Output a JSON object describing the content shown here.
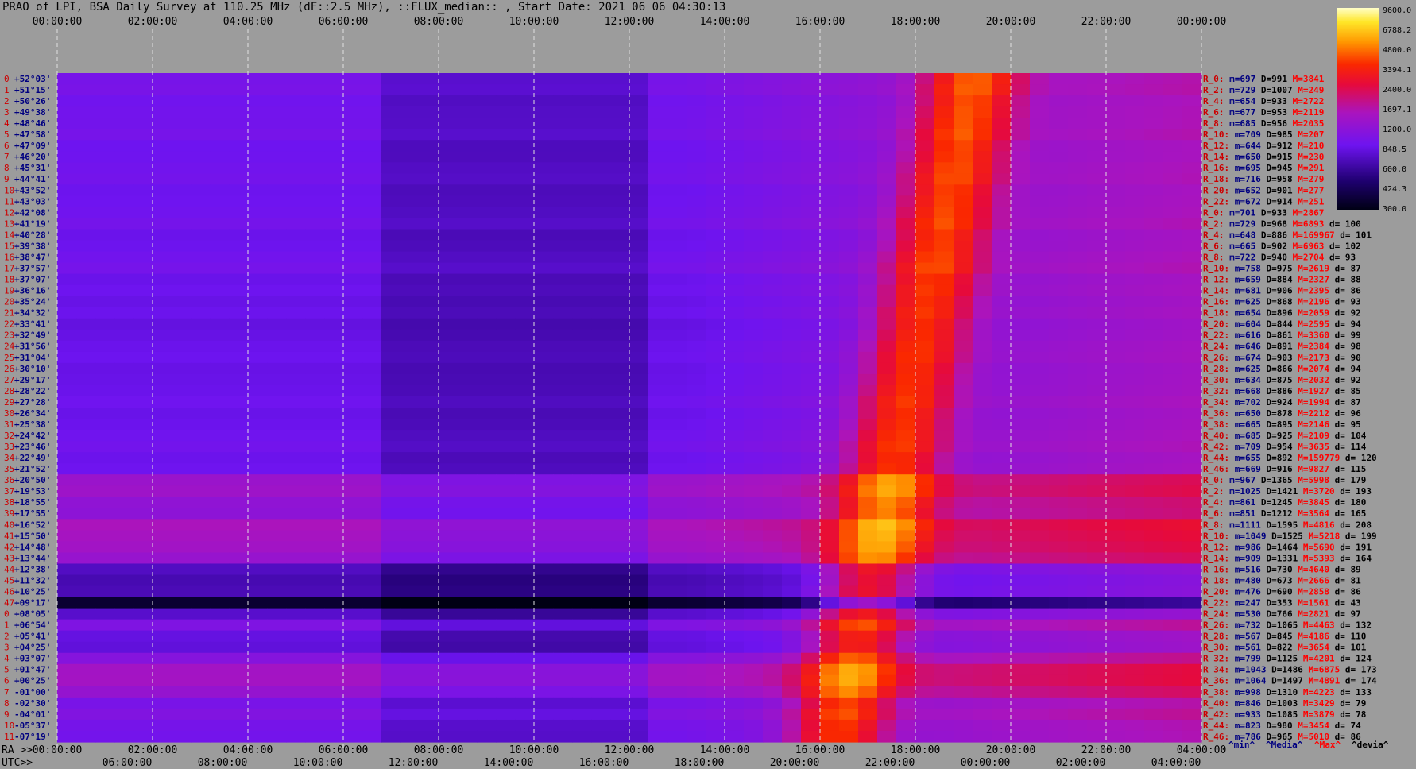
{
  "title": "PRAO of LPI, BSA Daily Survey at 110.25 MHz (dF::2.5 MHz), ::FLUX_median:: , Start Date: 2021 06 06 04:30:13",
  "chart_data": {
    "type": "heatmap",
    "x_top_ticks": [
      "00:00:00",
      "02:00:00",
      "04:00:00",
      "06:00:00",
      "08:00:00",
      "10:00:00",
      "12:00:00",
      "14:00:00",
      "16:00:00",
      "18:00:00",
      "20:00:00",
      "22:00:00",
      "00:00:00"
    ],
    "ra_label": "RA >>",
    "ra_ticks": [
      "00:00:00",
      "02:00:00",
      "04:00:00",
      "06:00:00",
      "08:00:00",
      "10:00:00",
      "12:00:00",
      "14:00:00",
      "16:00:00",
      "18:00:00",
      "20:00:00",
      "22:00:00",
      "04:00:00"
    ],
    "utc_label": "UTC>>",
    "utc_ticks": [
      "06:00:00",
      "08:00:00",
      "10:00:00",
      "12:00:00",
      "14:00:00",
      "16:00:00",
      "18:00:00",
      "20:00:00",
      "22:00:00",
      "00:00:00",
      "02:00:00",
      "04:00:00"
    ],
    "declinations": [
      "+52°03'",
      "+51°15'",
      "+50°26'",
      "+49°38'",
      "+48°46'",
      "+47°58'",
      "+47°09'",
      "+46°20'",
      "+45°31'",
      "+44°41'",
      "+43°52'",
      "+43°03'",
      "+42°08'",
      "+41°19'",
      "+40°28'",
      "+39°38'",
      "+38°47'",
      "+37°57'",
      "+37°07'",
      "+36°16'",
      "+35°24'",
      "+34°32'",
      "+33°41'",
      "+32°49'",
      "+31°56'",
      "+31°04'",
      "+30°10'",
      "+29°17'",
      "+28°22'",
      "+27°28'",
      "+26°34'",
      "+25°38'",
      "+24°42'",
      "+23°46'",
      "+22°49'",
      "+21°52'",
      "+20°50'",
      "+19°53'",
      "+18°55'",
      "+17°55'",
      "+16°52'",
      "+15°50'",
      "+14°48'",
      "+13°44'",
      "+12°38'",
      "+11°32'",
      "+10°25'",
      "+09°17'",
      "+08°05'",
      "+06°54'",
      "+05°41'",
      "+04°25'",
      "+03°07'",
      "+01°47'",
      "+00°25'",
      "-01°00'",
      "-02°30'",
      "-04°01'",
      "-05°37'",
      "-07°19'"
    ],
    "colorbar_ticks": [
      "9600.0",
      "6788.2",
      "4800.0",
      "3394.1",
      "2400.0",
      "1697.1",
      "1200.0",
      "848.5",
      "600.0",
      "424.3",
      "300.0"
    ],
    "stats_rows": [
      {
        "r": "R_0:",
        "m": "m=697",
        "d": "D=991",
        "M": "M=3841",
        "dev": ""
      },
      {
        "r": "R_2:",
        "m": "m=729",
        "d": "D=1007",
        "M": "M=249",
        "dev": ""
      },
      {
        "r": "R_4:",
        "m": "m=654",
        "d": "D=933",
        "M": "M=2722",
        "dev": ""
      },
      {
        "r": "R_6:",
        "m": "m=677",
        "d": "D=953",
        "M": "M=2119",
        "dev": ""
      },
      {
        "r": "R_8:",
        "m": "m=685",
        "d": "D=956",
        "M": "M=2035",
        "dev": ""
      },
      {
        "r": "R_10:",
        "m": "m=709",
        "d": "D=985",
        "M": "M=207",
        "dev": ""
      },
      {
        "r": "R_12:",
        "m": "m=644",
        "d": "D=912",
        "M": "M=210",
        "dev": ""
      },
      {
        "r": "R_14:",
        "m": "m=650",
        "d": "D=915",
        "M": "M=230",
        "dev": ""
      },
      {
        "r": "R_16:",
        "m": "m=695",
        "d": "D=945",
        "M": "M=291",
        "dev": ""
      },
      {
        "r": "R_18:",
        "m": "m=716",
        "d": "D=958",
        "M": "M=279",
        "dev": ""
      },
      {
        "r": "R_20:",
        "m": "m=652",
        "d": "D=901",
        "M": "M=277",
        "dev": ""
      },
      {
        "r": "R_22:",
        "m": "m=672",
        "d": "D=914",
        "M": "M=251",
        "dev": ""
      },
      {
        "r": "R_0:",
        "m": "m=701",
        "d": "D=933",
        "M": "M=2867",
        "dev": ""
      },
      {
        "r": "R_2:",
        "m": "m=729",
        "d": "D=968",
        "M": "M=6893",
        "dev": "d= 100"
      },
      {
        "r": "R_4:",
        "m": "m=648",
        "d": "D=886",
        "M": "M=169967",
        "dev": "d= 101"
      },
      {
        "r": "R_6:",
        "m": "m=665",
        "d": "D=902",
        "M": "M=6963",
        "dev": "d= 102"
      },
      {
        "r": "R_8:",
        "m": "m=722",
        "d": "D=940",
        "M": "M=2704",
        "dev": "d= 93"
      },
      {
        "r": "R_10:",
        "m": "m=758",
        "d": "D=975",
        "M": "M=2619",
        "dev": "d= 87"
      },
      {
        "r": "R_12:",
        "m": "m=659",
        "d": "D=884",
        "M": "M=2327",
        "dev": "d= 88"
      },
      {
        "r": "R_14:",
        "m": "m=681",
        "d": "D=906",
        "M": "M=2395",
        "dev": "d= 86"
      },
      {
        "r": "R_16:",
        "m": "m=625",
        "d": "D=868",
        "M": "M=2196",
        "dev": "d= 93"
      },
      {
        "r": "R_18:",
        "m": "m=654",
        "d": "D=896",
        "M": "M=2059",
        "dev": "d= 92"
      },
      {
        "r": "R_20:",
        "m": "m=604",
        "d": "D=844",
        "M": "M=2595",
        "dev": "d= 94"
      },
      {
        "r": "R_22:",
        "m": "m=616",
        "d": "D=861",
        "M": "M=3360",
        "dev": "d= 99"
      },
      {
        "r": "R_24:",
        "m": "m=646",
        "d": "D=891",
        "M": "M=2384",
        "dev": "d= 98"
      },
      {
        "r": "R_26:",
        "m": "m=674",
        "d": "D=903",
        "M": "M=2173",
        "dev": "d= 90"
      },
      {
        "r": "R_28:",
        "m": "m=625",
        "d": "D=866",
        "M": "M=2074",
        "dev": "d= 94"
      },
      {
        "r": "R_30:",
        "m": "m=634",
        "d": "D=875",
        "M": "M=2032",
        "dev": "d= 92"
      },
      {
        "r": "R_32:",
        "m": "m=668",
        "d": "D=886",
        "M": "M=1927",
        "dev": "d= 85"
      },
      {
        "r": "R_34:",
        "m": "m=702",
        "d": "D=924",
        "M": "M=1994",
        "dev": "d= 87"
      },
      {
        "r": "R_36:",
        "m": "m=650",
        "d": "D=878",
        "M": "M=2212",
        "dev": "d= 96"
      },
      {
        "r": "R_38:",
        "m": "m=665",
        "d": "D=895",
        "M": "M=2146",
        "dev": "d= 95"
      },
      {
        "r": "R_40:",
        "m": "m=685",
        "d": "D=925",
        "M": "M=2109",
        "dev": "d= 104"
      },
      {
        "r": "R_42:",
        "m": "m=709",
        "d": "D=954",
        "M": "M=3635",
        "dev": "d= 114"
      },
      {
        "r": "R_44:",
        "m": "m=655",
        "d": "D=892",
        "M": "M=159779",
        "dev": "d= 120"
      },
      {
        "r": "R_46:",
        "m": "m=669",
        "d": "D=916",
        "M": "M=9827",
        "dev": "d= 115"
      },
      {
        "r": "R_0:",
        "m": "m=967",
        "d": "D=1365",
        "M": "M=5998",
        "dev": "d= 179"
      },
      {
        "r": "R_2:",
        "m": "m=1025",
        "d": "D=1421",
        "M": "M=3720",
        "dev": "d= 193"
      },
      {
        "r": "R_4:",
        "m": "m=861",
        "d": "D=1245",
        "M": "M=3845",
        "dev": "d= 180"
      },
      {
        "r": "R_6:",
        "m": "m=851",
        "d": "D=1212",
        "M": "M=3564",
        "dev": "d= 165"
      },
      {
        "r": "R_8:",
        "m": "m=1111",
        "d": "D=1595",
        "M": "M=4816",
        "dev": "d= 208"
      },
      {
        "r": "R_10:",
        "m": "m=1049",
        "d": "D=1525",
        "M": "M=5218",
        "dev": "d= 199"
      },
      {
        "r": "R_12:",
        "m": "m=986",
        "d": "D=1464",
        "M": "M=5690",
        "dev": "d= 191"
      },
      {
        "r": "R_14:",
        "m": "m=909",
        "d": "D=1331",
        "M": "M=5393",
        "dev": "d= 164"
      },
      {
        "r": "R_16:",
        "m": "m=516",
        "d": "D=730",
        "M": "M=4640",
        "dev": "d= 89"
      },
      {
        "r": "R_18:",
        "m": "m=480",
        "d": "D=673",
        "M": "M=2666",
        "dev": "d= 81"
      },
      {
        "r": "R_20:",
        "m": "m=476",
        "d": "D=690",
        "M": "M=2858",
        "dev": "d= 86"
      },
      {
        "r": "R_22:",
        "m": "m=247",
        "d": "D=353",
        "M": "M=1561",
        "dev": "d= 43"
      },
      {
        "r": "R_24:",
        "m": "m=530",
        "d": "D=766",
        "M": "M=2821",
        "dev": "d= 97"
      },
      {
        "r": "R_26:",
        "m": "m=732",
        "d": "D=1065",
        "M": "M=4463",
        "dev": "d= 132"
      },
      {
        "r": "R_28:",
        "m": "m=567",
        "d": "D=845",
        "M": "M=4186",
        "dev": "d= 110"
      },
      {
        "r": "R_30:",
        "m": "m=561",
        "d": "D=822",
        "M": "M=3654",
        "dev": "d= 101"
      },
      {
        "r": "R_32:",
        "m": "m=799",
        "d": "D=1125",
        "M": "M=4201",
        "dev": "d= 124"
      },
      {
        "r": "R_34:",
        "m": "m=1043",
        "d": "D=1486",
        "M": "M=6875",
        "dev": "d= 173"
      },
      {
        "r": "R_36:",
        "m": "m=1064",
        "d": "D=1497",
        "M": "M=4891",
        "dev": "d= 174"
      },
      {
        "r": "R_38:",
        "m": "m=998",
        "d": "D=1310",
        "M": "M=4223",
        "dev": "d= 133"
      },
      {
        "r": "R_40:",
        "m": "m=846",
        "d": "D=1003",
        "M": "M=3429",
        "dev": "d= 79"
      },
      {
        "r": "R_42:",
        "m": "m=933",
        "d": "D=1085",
        "M": "M=3879",
        "dev": "d= 78"
      },
      {
        "r": "R_44:",
        "m": "m=823",
        "d": "D=980",
        "M": "M=3454",
        "dev": "d= 74"
      },
      {
        "r": "R_46:",
        "m": "m=786",
        "d": "D=965",
        "M": "M=5010",
        "dev": "d= 86"
      }
    ],
    "footer_legend": [
      "^min^",
      "^Media^",
      "^Max^",
      "^devia^"
    ],
    "colors": {
      "background": "#9c9c9c",
      "dec_label": "#000080",
      "stat_r": "#cc0000",
      "stat_m": "#000080",
      "stat_d": "#000000",
      "stat_M": "#ff0000",
      "stat_dev": "#000000",
      "grid": "#e0e0e0"
    }
  }
}
